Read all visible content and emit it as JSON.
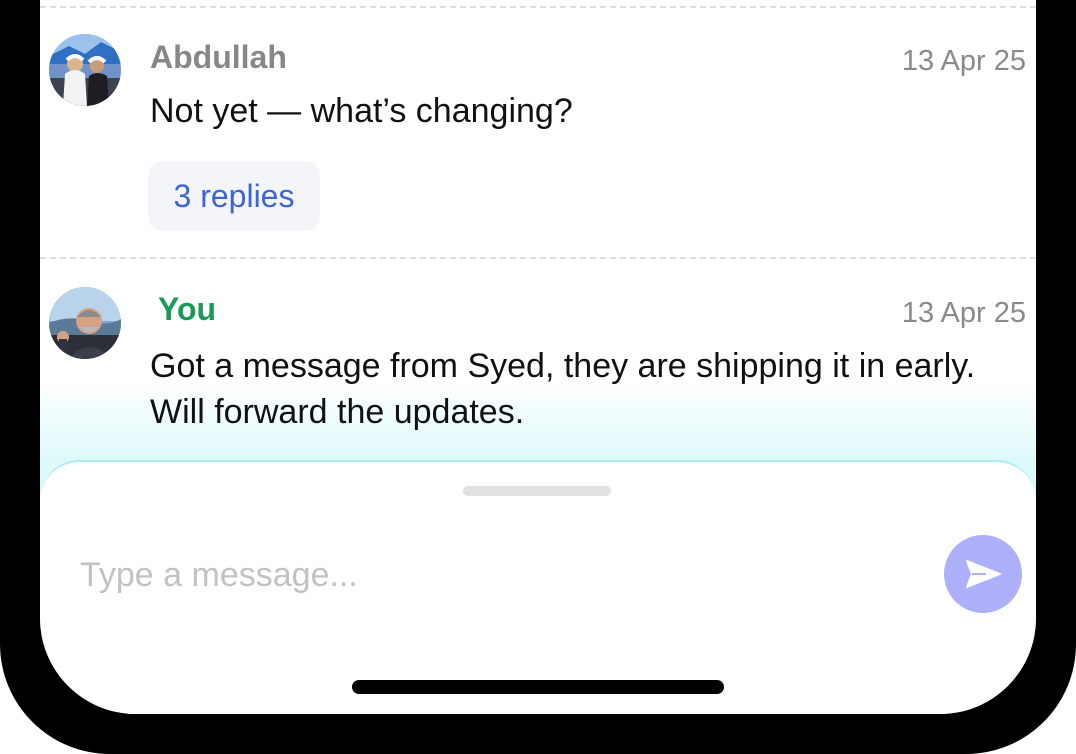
{
  "thread": {
    "messages": [
      {
        "sender": "Abdullah",
        "timestamp": "13 Apr 25",
        "text": "Not yet — what’s changing?",
        "replies_label": "3 replies",
        "sender_color": "#878787"
      },
      {
        "sender": "You",
        "timestamp": "13 Apr 25",
        "text": "Got a message from Syed, they are shipping it in early. Will forward the updates.",
        "sender_color": "#1a9a55"
      }
    ]
  },
  "composer": {
    "placeholder": "Type a message...",
    "value": "",
    "send_icon": "send-icon"
  },
  "colors": {
    "accent_link": "#3c64d6",
    "send_button": "#aeb0fc",
    "composer_glow": "#ddf9fb"
  }
}
